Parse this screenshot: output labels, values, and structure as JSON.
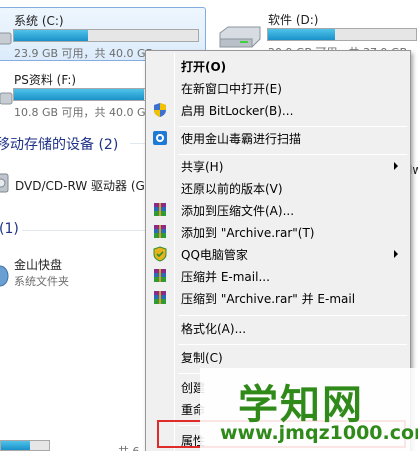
{
  "drives": [
    {
      "name": "系统 (C:)",
      "space": "23.9 GB 可用，共 40.0 GB",
      "used_fraction": 0.4,
      "selected": true
    },
    {
      "name": "软件 (D:)",
      "space": "20.9 GB 可用，共 37.9 GB",
      "used_fraction": 0.45,
      "selected": false
    },
    {
      "name": "PS资料 (F:)",
      "space": "10.8 GB 可用，共 40.0 GB",
      "used_fraction": 0.73,
      "selected": false
    }
  ],
  "removable_section": {
    "heading": "移动存储的设备 (2)"
  },
  "dvd_drive": {
    "name": "DVD/CD-RW 驱动器 (G"
  },
  "other_section": {
    "heading": "(1)"
  },
  "jinshan": {
    "name": "金山快盘",
    "desc": "系统文件夹"
  },
  "bottom_partial": {
    "space": "共 6"
  },
  "peek_text": "Mw",
  "context_menu": {
    "items": [
      {
        "label": "打开(O)",
        "bold": true,
        "icon": ""
      },
      {
        "label": "在新窗口中打开(E)",
        "icon": ""
      },
      {
        "label": "启用 BitLocker(B)...",
        "icon": "shield-icon"
      },
      {
        "label": "使用金山毒霸进行扫描",
        "icon": "duba-icon"
      },
      {
        "label": "共享(H)",
        "submenu": true,
        "icon": ""
      },
      {
        "label": "还原以前的版本(V)",
        "icon": ""
      },
      {
        "label": "添加到压缩文件(A)...",
        "icon": "winrar-icon"
      },
      {
        "label": "添加到 \"Archive.rar\"(T)",
        "icon": "winrar-icon"
      },
      {
        "label": "QQ电脑管家",
        "submenu": true,
        "icon": "qq-guard-icon"
      },
      {
        "label": "压缩并 E-mail...",
        "icon": "winrar-icon"
      },
      {
        "label": "压缩到 \"Archive.rar\" 并 E-mail",
        "icon": "winrar-icon"
      },
      {
        "label": "格式化(A)...",
        "icon": ""
      },
      {
        "label": "复制(C)",
        "icon": ""
      },
      {
        "label": "创建",
        "icon": ""
      },
      {
        "label": "重命",
        "icon": ""
      },
      {
        "label": "属性",
        "icon": ""
      }
    ]
  },
  "watermark": {
    "title": "学知网",
    "url": "www.jmqz1000.com"
  },
  "colors": {
    "highlight": "#e02b2b",
    "watermark": "#2f8a1a",
    "section_heading": "#1e3287"
  }
}
